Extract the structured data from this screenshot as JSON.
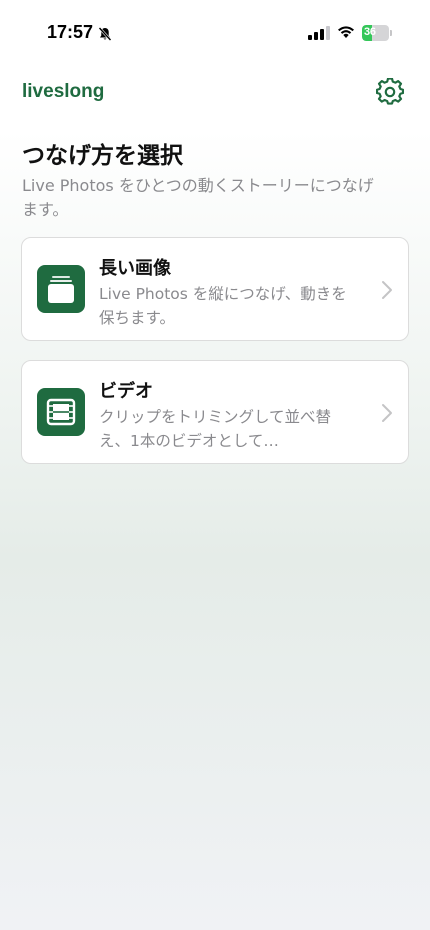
{
  "status_bar": {
    "time": "17:57",
    "battery_level": 36,
    "battery_label": "36"
  },
  "nav": {
    "app_title": "liveslong",
    "settings_icon": "gear-icon"
  },
  "header": {
    "title": "つなげ方を選択",
    "subtitle": "Live Photos をひとつの動くストーリーにつなげます。"
  },
  "options": [
    {
      "title": "長い画像",
      "description": "Live Photos を縦につなげ、動きを保ちます。",
      "icon": "stacked-photos-icon"
    },
    {
      "title": "ビデオ",
      "description": "クリップをトリミングして並べ替え、1本のビデオとして…",
      "icon": "film-icon"
    }
  ],
  "colors": {
    "accent": "#1f6b40",
    "secondary_text": "#8a8a8e"
  }
}
